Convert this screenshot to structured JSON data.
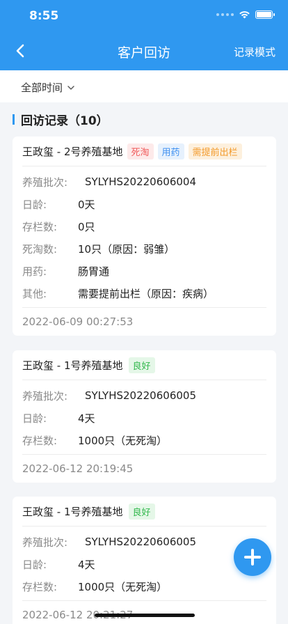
{
  "status_bar": {
    "time": "8:55"
  },
  "nav": {
    "title": "客户回访",
    "right_action": "记录模式"
  },
  "filter": {
    "label": "全部时间"
  },
  "section": {
    "title": "回访记录（10）"
  },
  "records": [
    {
      "name": "王政玺 - 2号养殖基地",
      "tags": [
        {
          "text": "死淘",
          "color": "red"
        },
        {
          "text": "用药",
          "color": "blue"
        },
        {
          "text": "需提前出栏",
          "color": "orange"
        }
      ],
      "fields": [
        {
          "label": "养殖批次:",
          "value": "SYLYHS20220606004"
        },
        {
          "label": "日龄:",
          "value": "0天"
        },
        {
          "label": "存栏数:",
          "value": "0只"
        },
        {
          "label": "死淘数:",
          "value": "10只（原因：弱雏）"
        },
        {
          "label": "用药:",
          "value": "肠胃通"
        },
        {
          "label": "其他:",
          "value": "需要提前出栏（原因：疾病）"
        }
      ],
      "time": "2022-06-09 00:27:53"
    },
    {
      "name": "王政玺 - 1号养殖基地",
      "tags": [
        {
          "text": "良好",
          "color": "green"
        }
      ],
      "fields": [
        {
          "label": "养殖批次:",
          "value": "SYLYHS20220606005"
        },
        {
          "label": "日龄:",
          "value": "4天"
        },
        {
          "label": "存栏数:",
          "value": "1000只（无死淘）"
        }
      ],
      "time": "2022-06-12 20:19:45"
    },
    {
      "name": "王政玺 - 1号养殖基地",
      "tags": [
        {
          "text": "良好",
          "color": "green"
        }
      ],
      "fields": [
        {
          "label": "养殖批次:",
          "value": "SYLYHS20220606005"
        },
        {
          "label": "日龄:",
          "value": "4天"
        },
        {
          "label": "存栏数:",
          "value": "1000只（无死淘）"
        }
      ],
      "time": "2022-06-12 20:21:27"
    }
  ],
  "icons": {
    "back": "chevron-left-icon",
    "filter_toggle": "chevron-down-icon",
    "add": "plus-icon"
  },
  "colors": {
    "primary": "#2f98f0",
    "tag_red": "#f05a5a",
    "tag_blue": "#3d8ff0",
    "tag_orange": "#f39a2b",
    "tag_green": "#32b84d"
  }
}
